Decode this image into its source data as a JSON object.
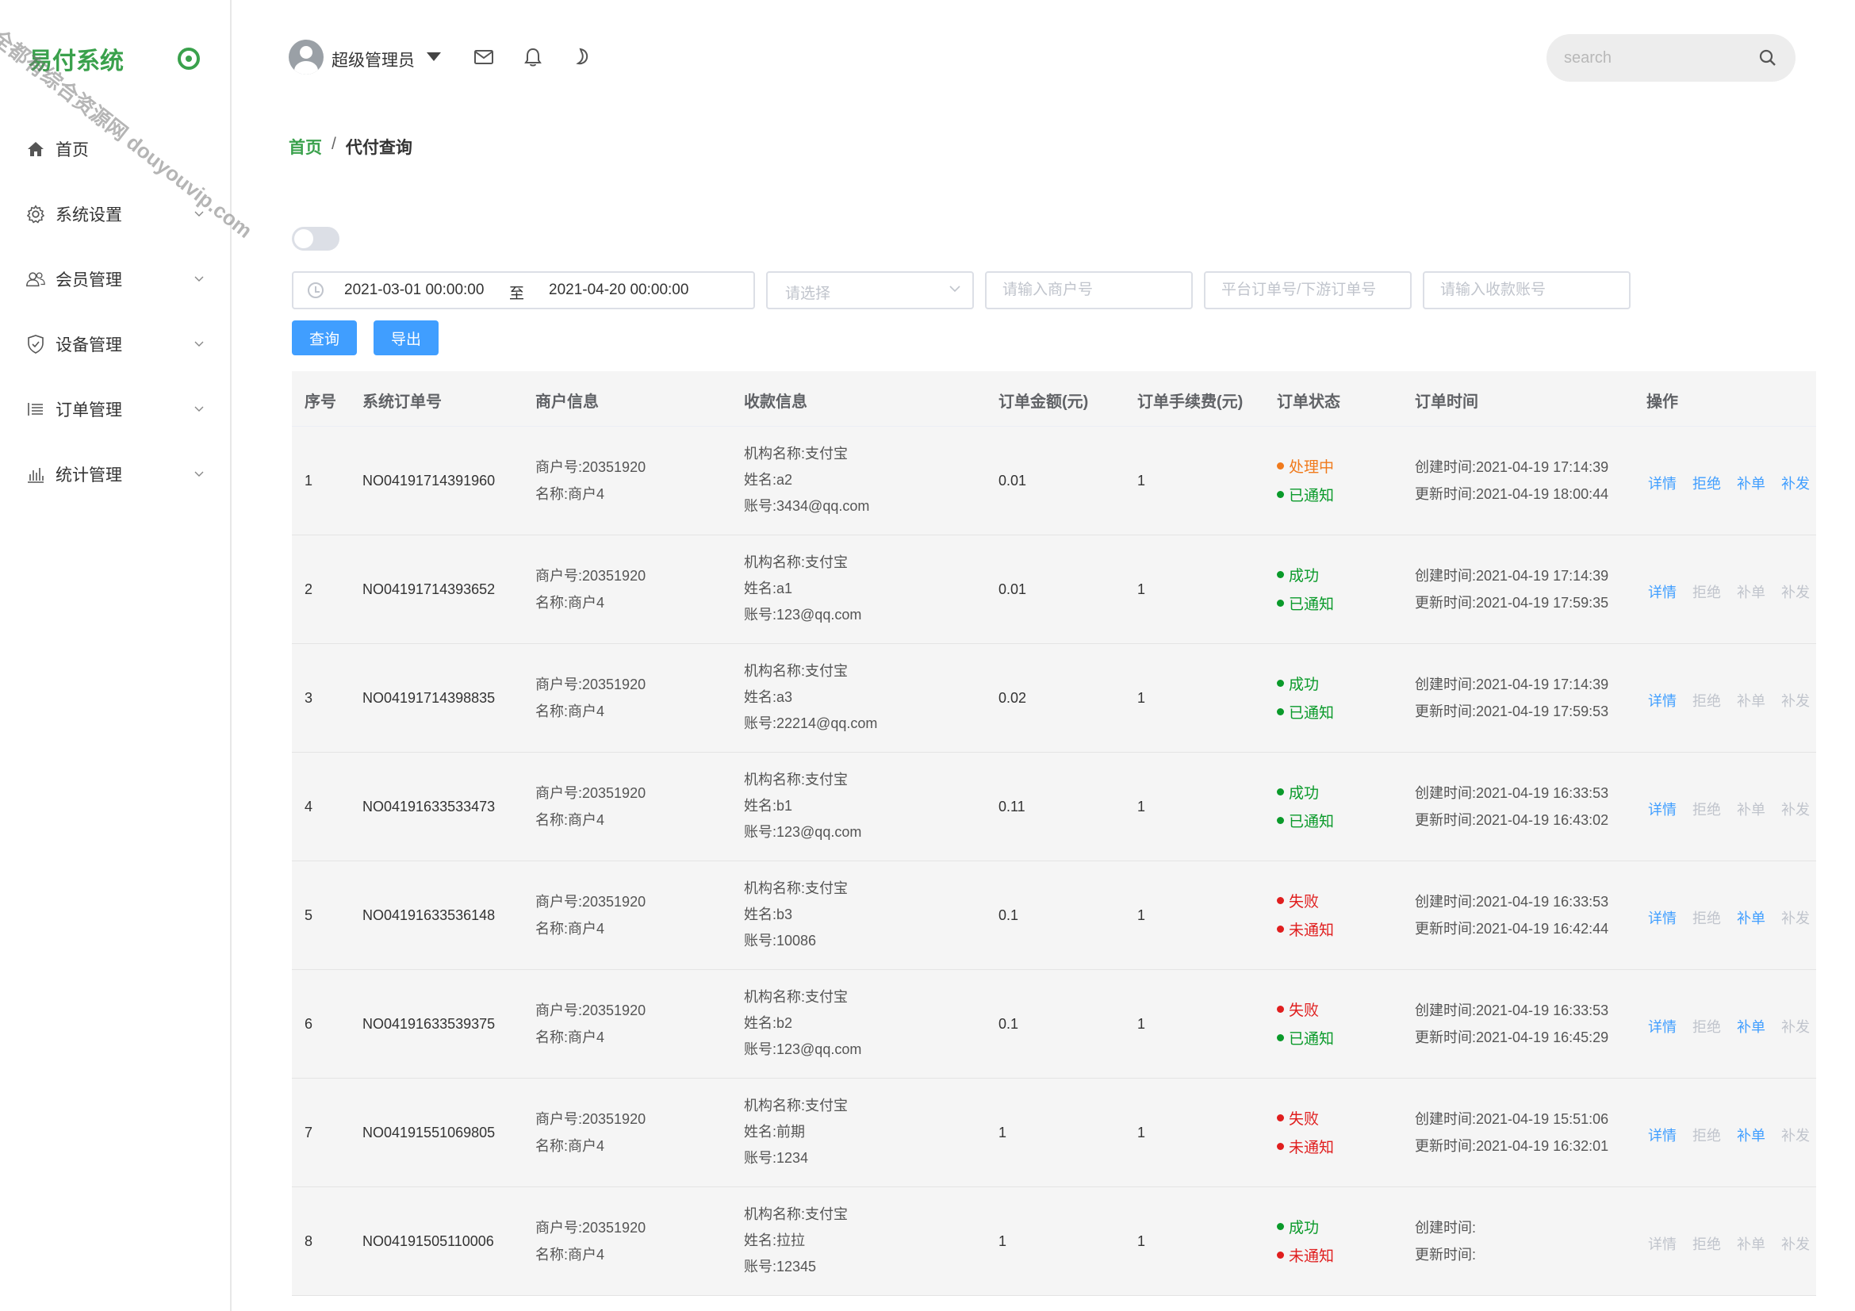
{
  "sidebar": {
    "logo": "易付系统",
    "watermark": "全都有综合资源网 douyouvip.com",
    "items": [
      {
        "label": "首页",
        "icon": "home-icon"
      },
      {
        "label": "系统设置",
        "icon": "gear-icon"
      },
      {
        "label": "会员管理",
        "icon": "users-icon"
      },
      {
        "label": "设备管理",
        "icon": "shield-icon"
      },
      {
        "label": "订单管理",
        "icon": "list-icon"
      },
      {
        "label": "统计管理",
        "icon": "bar-chart-icon"
      }
    ]
  },
  "header": {
    "user_name": "超级管理员",
    "icons": [
      "mail-icon",
      "bell-icon",
      "moon-icon"
    ],
    "search_placeholder": "search"
  },
  "breadcrumb": {
    "home": "首页",
    "separator": "/",
    "current": "代付查询"
  },
  "filters": {
    "date_start": "2021-03-01 00:00:00",
    "date_separator": "至",
    "date_end": "2021-04-20 00:00:00",
    "select_placeholder": "请选择",
    "merchant_placeholder": "请输入商户号",
    "order_placeholder": "平台订单号/下游订单号",
    "account_placeholder": "请输入收款账号",
    "query_label": "查询",
    "export_label": "导出"
  },
  "colors": {
    "accent": "#3aa14c",
    "primary": "#409eff",
    "success": "#0a9a2a",
    "processing": "#f07a1c",
    "failed": "#e01e1e"
  },
  "table": {
    "headers": [
      "序号",
      "系统订单号",
      "商户信息",
      "收款信息",
      "订单金额(元)",
      "订单手续费(元)",
      "订单状态",
      "订单时间",
      "操作"
    ],
    "op_labels": [
      "详情",
      "拒绝",
      "补单",
      "补发"
    ],
    "rows": [
      {
        "idx": "1",
        "order_no": "NO04191714391960",
        "merchant_no": "商户号:20351920",
        "merchant_name": "名称:商户4",
        "org": "机构名称:支付宝",
        "payee": "姓名:a2",
        "account": "账号:3434@qq.com",
        "amount": "0.01",
        "fee": "1",
        "status": "处理中",
        "status_color": "#f07a1c",
        "notify": "已通知",
        "notify_color": "#0a9a2a",
        "created": "创建时间:2021-04-19 17:14:39",
        "updated": "更新时间:2021-04-19 18:00:44",
        "ops_enabled": [
          true,
          true,
          true,
          true
        ]
      },
      {
        "idx": "2",
        "order_no": "NO04191714393652",
        "merchant_no": "商户号:20351920",
        "merchant_name": "名称:商户4",
        "org": "机构名称:支付宝",
        "payee": "姓名:a1",
        "account": "账号:123@qq.com",
        "amount": "0.01",
        "fee": "1",
        "status": "成功",
        "status_color": "#0a9a2a",
        "notify": "已通知",
        "notify_color": "#0a9a2a",
        "created": "创建时间:2021-04-19 17:14:39",
        "updated": "更新时间:2021-04-19 17:59:35",
        "ops_enabled": [
          true,
          false,
          false,
          false
        ]
      },
      {
        "idx": "3",
        "order_no": "NO04191714398835",
        "merchant_no": "商户号:20351920",
        "merchant_name": "名称:商户4",
        "org": "机构名称:支付宝",
        "payee": "姓名:a3",
        "account": "账号:22214@qq.com",
        "amount": "0.02",
        "fee": "1",
        "status": "成功",
        "status_color": "#0a9a2a",
        "notify": "已通知",
        "notify_color": "#0a9a2a",
        "created": "创建时间:2021-04-19 17:14:39",
        "updated": "更新时间:2021-04-19 17:59:53",
        "ops_enabled": [
          true,
          false,
          false,
          false
        ]
      },
      {
        "idx": "4",
        "order_no": "NO04191633533473",
        "merchant_no": "商户号:20351920",
        "merchant_name": "名称:商户4",
        "org": "机构名称:支付宝",
        "payee": "姓名:b1",
        "account": "账号:123@qq.com",
        "amount": "0.11",
        "fee": "1",
        "status": "成功",
        "status_color": "#0a9a2a",
        "notify": "已通知",
        "notify_color": "#0a9a2a",
        "created": "创建时间:2021-04-19 16:33:53",
        "updated": "更新时间:2021-04-19 16:43:02",
        "ops_enabled": [
          true,
          false,
          false,
          false
        ]
      },
      {
        "idx": "5",
        "order_no": "NO04191633536148",
        "merchant_no": "商户号:20351920",
        "merchant_name": "名称:商户4",
        "org": "机构名称:支付宝",
        "payee": "姓名:b3",
        "account": "账号:10086",
        "amount": "0.1",
        "fee": "1",
        "status": "失败",
        "status_color": "#e01e1e",
        "notify": "未通知",
        "notify_color": "#e01e1e",
        "created": "创建时间:2021-04-19 16:33:53",
        "updated": "更新时间:2021-04-19 16:42:44",
        "ops_enabled": [
          true,
          false,
          true,
          false
        ]
      },
      {
        "idx": "6",
        "order_no": "NO04191633539375",
        "merchant_no": "商户号:20351920",
        "merchant_name": "名称:商户4",
        "org": "机构名称:支付宝",
        "payee": "姓名:b2",
        "account": "账号:123@qq.com",
        "amount": "0.1",
        "fee": "1",
        "status": "失败",
        "status_color": "#e01e1e",
        "notify": "已通知",
        "notify_color": "#0a9a2a",
        "created": "创建时间:2021-04-19 16:33:53",
        "updated": "更新时间:2021-04-19 16:45:29",
        "ops_enabled": [
          true,
          false,
          true,
          false
        ]
      },
      {
        "idx": "7",
        "order_no": "NO04191551069805",
        "merchant_no": "商户号:20351920",
        "merchant_name": "名称:商户4",
        "org": "机构名称:支付宝",
        "payee": "姓名:前期",
        "account": "账号:1234",
        "amount": "1",
        "fee": "1",
        "status": "失败",
        "status_color": "#e01e1e",
        "notify": "未通知",
        "notify_color": "#e01e1e",
        "created": "创建时间:2021-04-19 15:51:06",
        "updated": "更新时间:2021-04-19 16:32:01",
        "ops_enabled": [
          true,
          false,
          true,
          false
        ]
      },
      {
        "idx": "8",
        "order_no": "NO04191505110006",
        "merchant_no": "商户号:20351920",
        "merchant_name": "名称:商户4",
        "org": "机构名称:支付宝",
        "payee": "姓名:拉拉",
        "account": "账号:12345",
        "amount": "1",
        "fee": "1",
        "status": "成功",
        "status_color": "#0a9a2a",
        "notify": "未通知",
        "notify_color": "#e01e1e",
        "created": "创建时间:",
        "updated": "更新时间:",
        "ops_enabled": [
          false,
          false,
          false,
          false
        ]
      }
    ]
  }
}
